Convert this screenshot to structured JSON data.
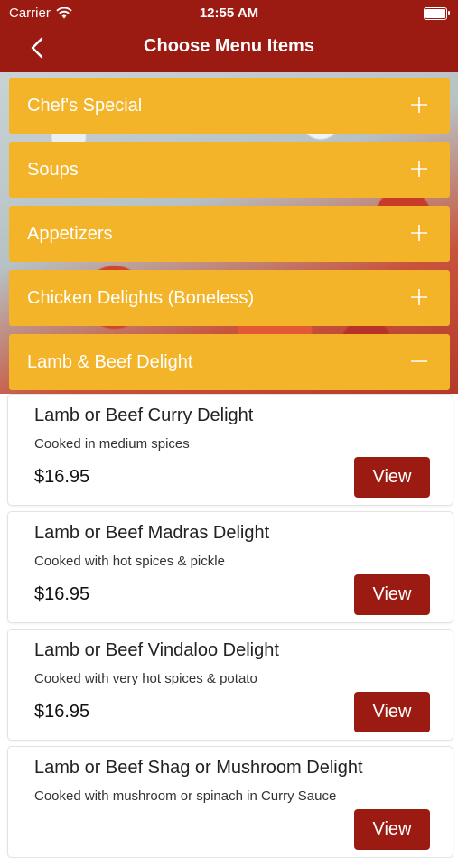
{
  "status_bar": {
    "carrier": "Carrier",
    "time": "12:55 AM"
  },
  "header": {
    "title": "Choose Menu Items"
  },
  "categories": [
    {
      "label": "Chef's Special",
      "expanded": false
    },
    {
      "label": "Soups",
      "expanded": false
    },
    {
      "label": "Appetizers",
      "expanded": false
    },
    {
      "label": "Chicken Delights (Boneless)",
      "expanded": false
    },
    {
      "label": "Lamb & Beef Delight",
      "expanded": true
    }
  ],
  "items": [
    {
      "name": "Lamb or Beef Curry Delight",
      "description": "Cooked in medium spices",
      "price": "$16.95",
      "button": "View"
    },
    {
      "name": "Lamb or Beef Madras Delight",
      "description": "Cooked with hot spices & pickle",
      "price": "$16.95",
      "button": "View"
    },
    {
      "name": "Lamb or Beef Vindaloo Delight",
      "description": "Cooked with very hot spices & potato",
      "price": "$16.95",
      "button": "View"
    },
    {
      "name": "Lamb or Beef Shag or Mushroom Delight",
      "description": "Cooked with mushroom or spinach in Curry Sauce",
      "price": "",
      "button": "View"
    }
  ],
  "colors": {
    "header": "#9b1a12",
    "category": "#f3b42a",
    "button": "#9b1a12"
  }
}
